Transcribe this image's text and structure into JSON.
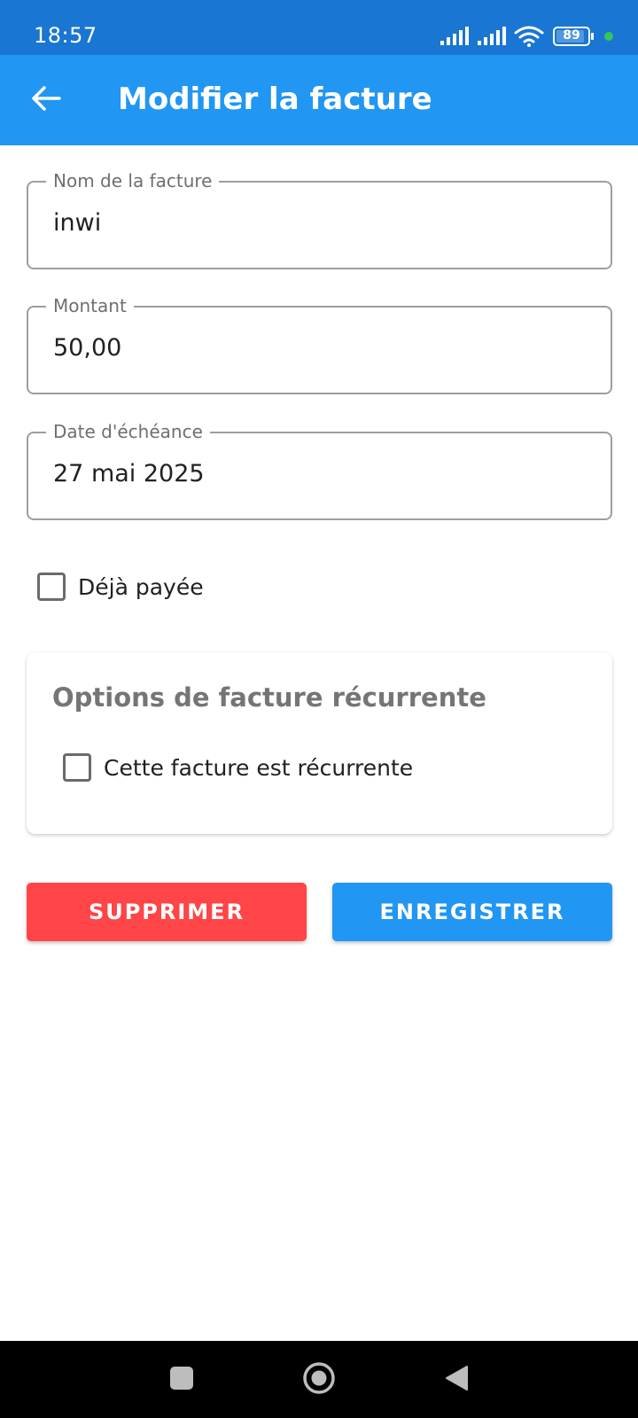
{
  "status_bar": {
    "time": "18:57",
    "battery": "89",
    "icons": [
      "signal-icon",
      "signal-icon",
      "wifi-icon",
      "battery-icon",
      "notification-dot-icon"
    ],
    "colors": {
      "background": "#1976d2",
      "notification_dot": "#34c759"
    }
  },
  "app_bar": {
    "title": "Modifier la facture",
    "back_icon": "arrow-left-icon",
    "color": "#2196f3"
  },
  "form": {
    "name_field": {
      "label": "Nom de la facture",
      "value": "inwi"
    },
    "amount_field": {
      "label": "Montant",
      "value": "50,00"
    },
    "date_field": {
      "label": "Date d'échéance",
      "value": "27 mai 2025"
    },
    "paid_checkbox": {
      "label": "Déjà payée",
      "checked": false
    }
  },
  "recurring_card": {
    "title": "Options de facture récurrente",
    "recurring_checkbox": {
      "label": "Cette facture est récurrente",
      "checked": false
    }
  },
  "actions": {
    "delete_label": "SUPPRIMER",
    "save_label": "ENREGISTRER",
    "colors": {
      "delete": "#ff4547",
      "save": "#2196f3"
    }
  },
  "nav_bar": {
    "icons": [
      "square-icon",
      "home-circle-icon",
      "back-triangle-icon"
    ]
  }
}
